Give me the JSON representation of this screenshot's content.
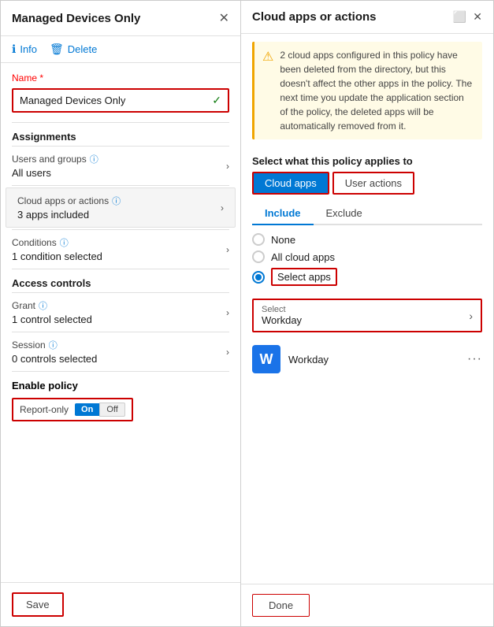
{
  "leftPanel": {
    "title": "Managed Devices Only",
    "actions": {
      "info": "Info",
      "delete": "Delete"
    },
    "name": {
      "label": "Name",
      "required": "*",
      "value": "Managed Devices Only"
    },
    "assignments": {
      "label": "Assignments",
      "usersAndGroups": {
        "title": "Users and groups",
        "value": "All users"
      },
      "cloudApps": {
        "title": "Cloud apps or actions",
        "value": "3 apps included"
      },
      "conditions": {
        "title": "Conditions",
        "value": "1 condition selected"
      }
    },
    "accessControls": {
      "label": "Access controls",
      "grant": {
        "title": "Grant",
        "value": "1 control selected"
      },
      "session": {
        "title": "Session",
        "value": "0 controls selected"
      }
    },
    "enablePolicy": {
      "label": "Enable policy",
      "toggleLabel": "Report-only",
      "onLabel": "On",
      "offLabel": "Off"
    },
    "saveButton": "Save"
  },
  "rightPanel": {
    "title": "Cloud apps or actions",
    "warning": "2 cloud apps configured in this policy have been deleted from the directory, but this doesn't affect the other apps in the policy. The next time you update the application section of the policy, the deleted apps will be automatically removed from it.",
    "policyAppliesLabel": "Select what this policy applies to",
    "tabs": {
      "cloudApps": "Cloud apps",
      "userActions": "User actions"
    },
    "includeTabs": {
      "include": "Include",
      "exclude": "Exclude"
    },
    "radioOptions": {
      "none": "None",
      "allCloudApps": "All cloud apps",
      "selectApps": "Select apps"
    },
    "selectBox": {
      "label": "Select",
      "value": "Workday"
    },
    "appItem": {
      "name": "Workday",
      "iconLetter": "W"
    },
    "doneButton": "Done"
  }
}
